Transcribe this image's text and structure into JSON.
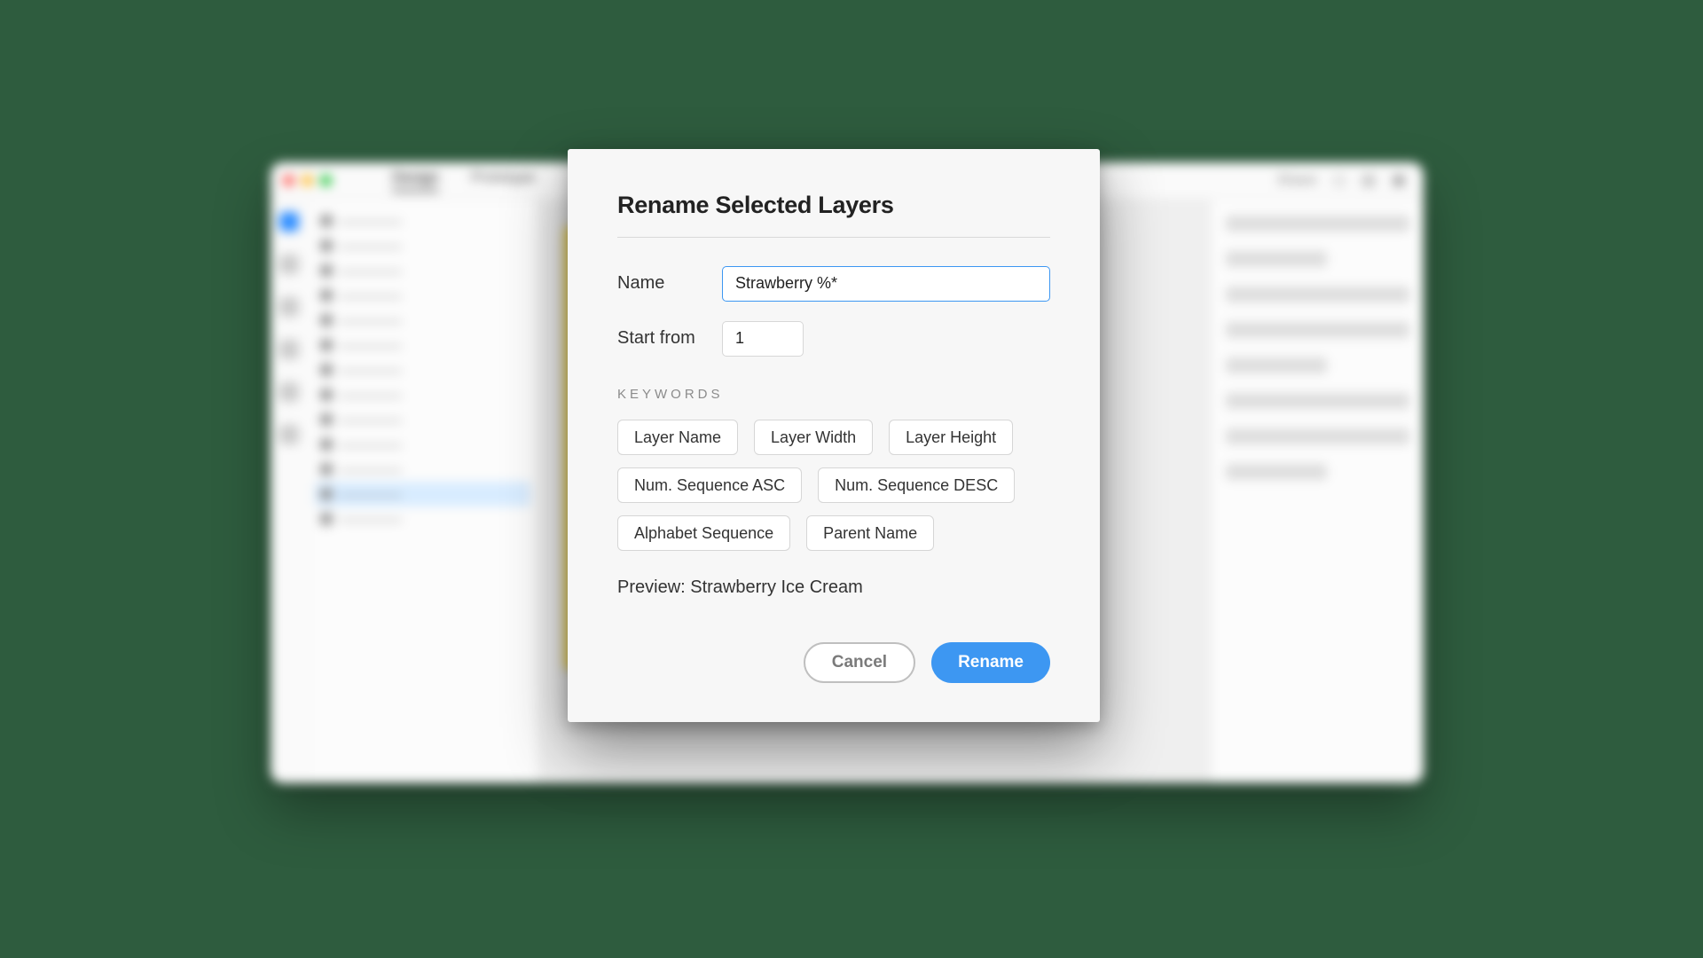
{
  "bg": {
    "tabs": {
      "design": "Design",
      "prototype": "Prototype"
    },
    "share": "Share"
  },
  "dialog": {
    "title": "Rename Selected Layers",
    "name_label": "Name",
    "name_value": "Strawberry %*",
    "startfrom_label": "Start from",
    "startfrom_value": "1",
    "keywords_label": "KEYWORDS",
    "keywords": [
      "Layer Name",
      "Layer Width",
      "Layer Height",
      "Num. Sequence ASC",
      "Num. Sequence DESC",
      "Alphabet Sequence",
      "Parent Name"
    ],
    "preview_label": "Preview: ",
    "preview_value": "Strawberry Ice Cream",
    "cancel_label": "Cancel",
    "rename_label": "Rename"
  }
}
